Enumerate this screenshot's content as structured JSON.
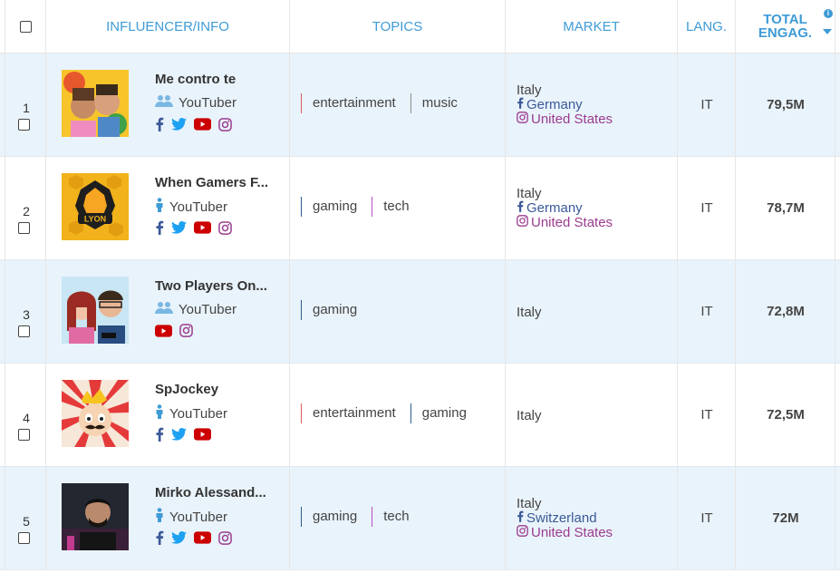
{
  "header": {
    "influencer": "INFLUENCER/INFO",
    "topics": "TOPICS",
    "market": "MARKET",
    "lang": "LANG.",
    "total_line1": "TOTAL",
    "total_line2": "ENGAG."
  },
  "rows": [
    {
      "rank": "1",
      "name": "Me contro te",
      "type": "YouTuber",
      "type_icon": "group-icon",
      "socials": [
        "facebook",
        "twitter",
        "youtube",
        "instagram"
      ],
      "topics": [
        "entertainment",
        "music"
      ],
      "topic_colors": [
        "#e05a5a",
        "#8a8a8a"
      ],
      "market": {
        "base": "Italy",
        "fb": "Germany",
        "ig": "United States"
      },
      "lang": "IT",
      "engagement": "79,5M"
    },
    {
      "rank": "2",
      "name": "When Gamers F...",
      "type": "YouTuber",
      "type_icon": "person-icon",
      "socials": [
        "facebook",
        "twitter",
        "youtube",
        "instagram"
      ],
      "topics": [
        "gaming",
        "tech"
      ],
      "topic_colors": [
        "#2c5b8f",
        "#b44fc0"
      ],
      "market": {
        "base": "Italy",
        "fb": "Germany",
        "ig": "United States"
      },
      "lang": "IT",
      "engagement": "78,7M"
    },
    {
      "rank": "3",
      "name": "Two Players On...",
      "type": "YouTuber",
      "type_icon": "group-icon",
      "socials": [
        "youtube",
        "instagram"
      ],
      "topics": [
        "gaming"
      ],
      "topic_colors": [
        "#2c5b8f"
      ],
      "market": {
        "base": "Italy"
      },
      "lang": "IT",
      "engagement": "72,8M"
    },
    {
      "rank": "4",
      "name": "SpJockey",
      "type": "YouTuber",
      "type_icon": "person-icon",
      "socials": [
        "facebook",
        "twitter",
        "youtube"
      ],
      "topics": [
        "entertainment",
        "gaming"
      ],
      "topic_colors": [
        "#e05a5a",
        "#2c5b8f"
      ],
      "market": {
        "base": "Italy"
      },
      "lang": "IT",
      "engagement": "72,5M"
    },
    {
      "rank": "5",
      "name": "Mirko Alessand...",
      "type": "YouTuber",
      "type_icon": "person-icon",
      "socials": [
        "facebook",
        "twitter",
        "youtube",
        "instagram"
      ],
      "topics": [
        "gaming",
        "tech"
      ],
      "topic_colors": [
        "#2c5b8f",
        "#b44fc0"
      ],
      "market": {
        "base": "Italy",
        "fb": "Switzerland",
        "ig": "United States"
      },
      "lang": "IT",
      "engagement": "72M"
    }
  ],
  "colors": {
    "accent": "#3e9bd6",
    "row_alt": "#e9f3fb",
    "facebook": "#3b5998",
    "twitter": "#1da1f2",
    "youtube": "#cc0000",
    "instagram": "#9b3b8f"
  }
}
